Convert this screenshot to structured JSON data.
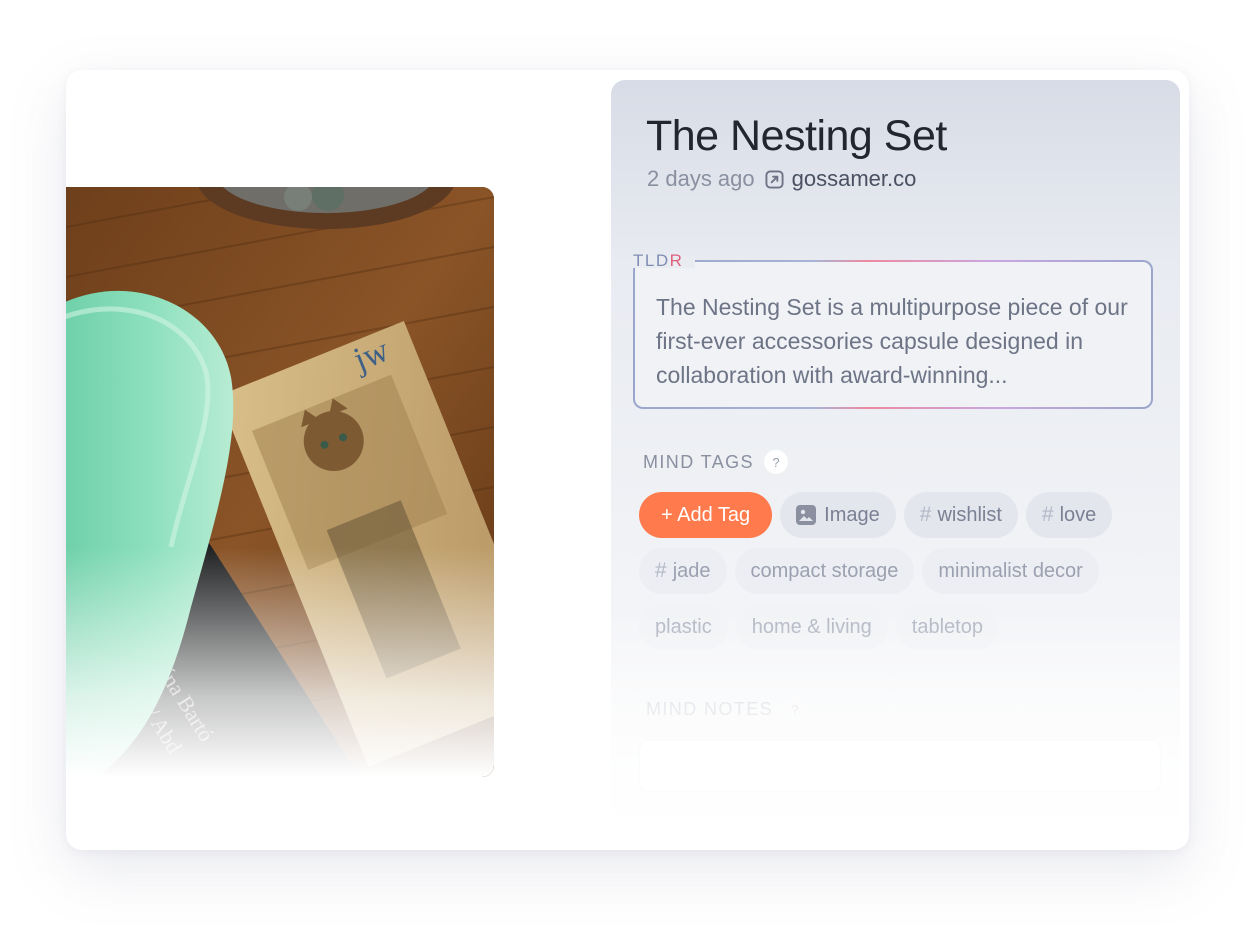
{
  "item": {
    "title": "The Nesting Set",
    "time_ago": "2 days ago",
    "domain": "gossamer.co"
  },
  "tldr": {
    "label_main": "TLD",
    "label_accent": "R",
    "text": "The Nesting Set is a multipurpose piece of our first-ever accessories capsule designed in collaboration with award-winning..."
  },
  "mind_tags": {
    "heading": "MIND TAGS",
    "help": "?",
    "add_label": "+ Add Tag",
    "image_label": "Image",
    "hash_tags": [
      "wishlist",
      "love",
      "jade"
    ],
    "topic_tags": [
      "compact storage",
      "minimalist decor",
      "plastic",
      "home & living",
      "tabletop"
    ]
  },
  "mind_notes": {
    "heading": "MIND NOTES",
    "help": "?"
  },
  "colors": {
    "accent": "#ff7a4c",
    "tldr_accent": "#e0607e",
    "title": "#23262f"
  },
  "icons": [
    "external-link-icon",
    "image-icon",
    "hash-icon",
    "help-icon"
  ]
}
